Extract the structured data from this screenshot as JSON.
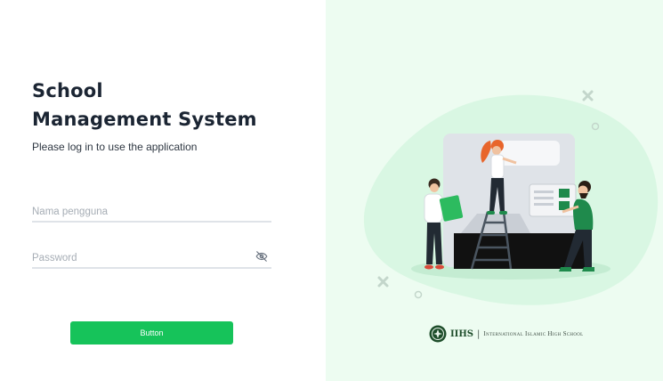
{
  "app": {
    "title_line1": "School",
    "title_line2": "Management System",
    "subtitle": "Please log in to use the application"
  },
  "form": {
    "username_placeholder": "Nama pengguna",
    "username_value": "",
    "password_placeholder": "Password",
    "password_value": "",
    "submit_label": "Button"
  },
  "branding": {
    "abbreviation": "IIHS",
    "divider": "|",
    "school_name": "International Islamic High School"
  },
  "colors": {
    "accent": "#16c35a",
    "panel_bg": "#edfcf1",
    "blob": "#d9f7e3"
  }
}
